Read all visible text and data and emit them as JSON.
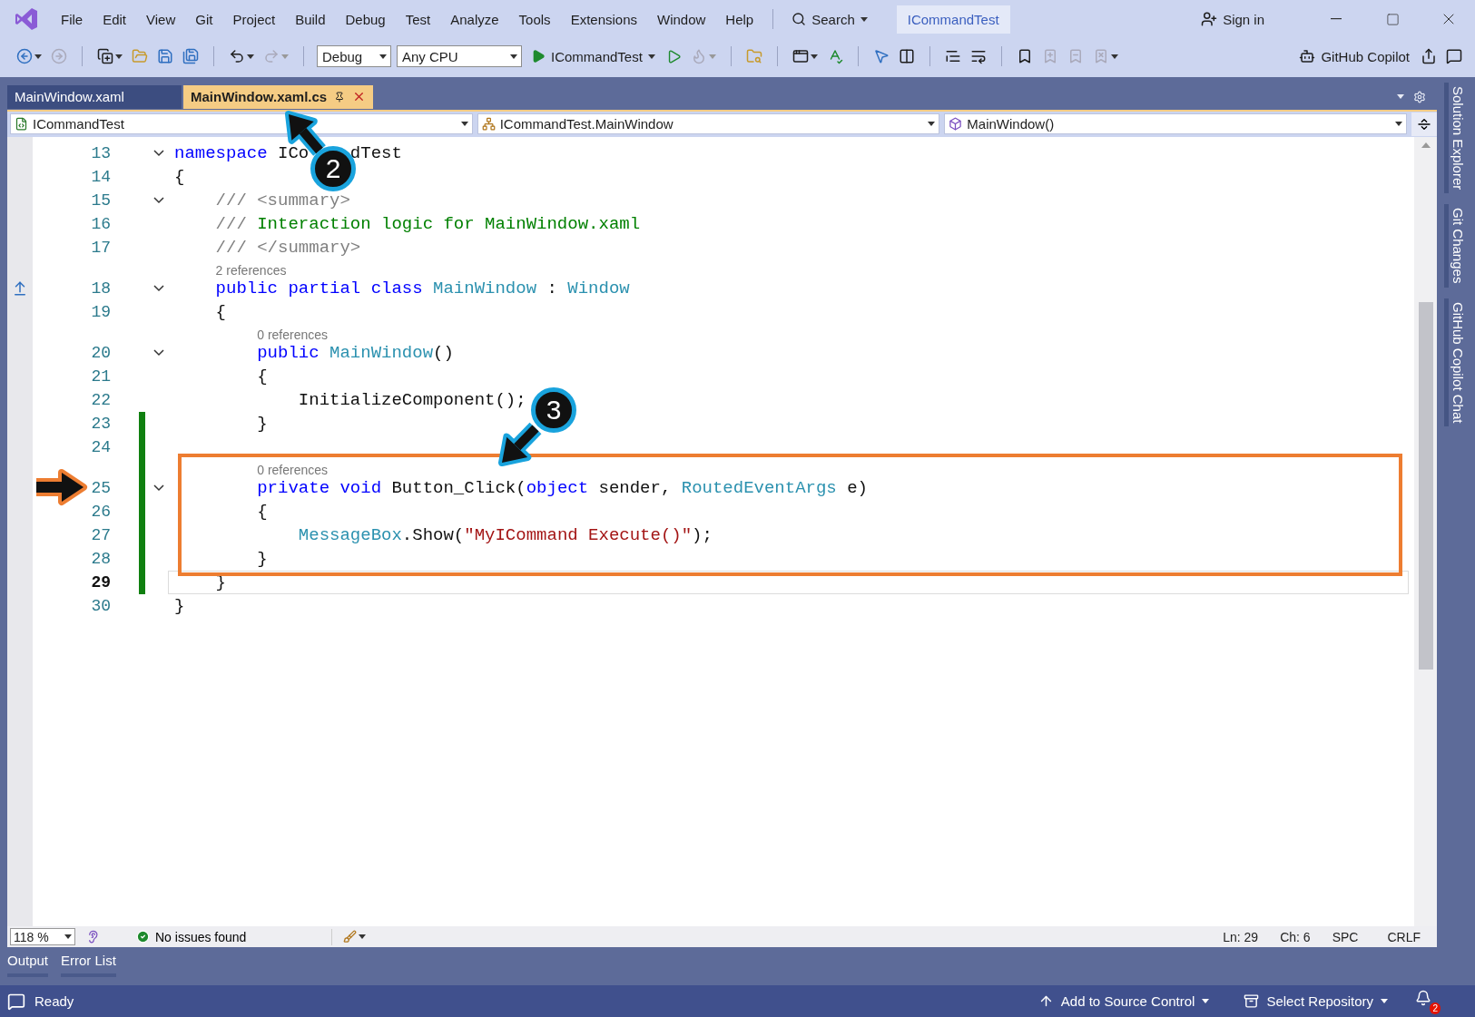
{
  "menu_bar": {
    "menus": [
      "File",
      "Edit",
      "View",
      "Git",
      "Project",
      "Build",
      "Debug",
      "Test",
      "Analyze",
      "Tools",
      "Extensions",
      "Window",
      "Help"
    ],
    "search": "Search",
    "solution": "ICommandTest",
    "sign_in": "Sign in"
  },
  "toolbar": {
    "configuration": "Debug",
    "platform": "Any CPU",
    "startup": "ICommandTest",
    "copilot": "GitHub Copilot"
  },
  "document_tabs": [
    {
      "label": "MainWindow.xaml",
      "selected": false
    },
    {
      "label": "MainWindow.xaml.cs",
      "selected": true
    }
  ],
  "navigation": {
    "project": "ICommandTest",
    "type": "ICommandTest.MainWindow",
    "member": "MainWindow()"
  },
  "code_lines": [
    {
      "kind": "code",
      "number": "13",
      "fold": true,
      "changed": false,
      "current": false,
      "marker": false,
      "tokens": [
        {
          "t": "namespace",
          "kind": "kw"
        },
        {
          "t": " ICo    dTest",
          "kind": "plain"
        }
      ]
    },
    {
      "kind": "code",
      "number": "14",
      "fold": false,
      "changed": false,
      "current": false,
      "marker": false,
      "tokens": [
        {
          "t": "{",
          "kind": "plain"
        }
      ]
    },
    {
      "kind": "code",
      "number": "15",
      "fold": true,
      "changed": false,
      "current": false,
      "marker": false,
      "tokens": [
        {
          "t": "    /// <summary>",
          "kind": "doc"
        }
      ]
    },
    {
      "kind": "code",
      "number": "16",
      "fold": false,
      "changed": false,
      "current": false,
      "marker": false,
      "tokens": [
        {
          "t": "    /// ",
          "kind": "doc"
        },
        {
          "t": "Interaction logic for MainWindow.xaml",
          "kind": "comment"
        }
      ]
    },
    {
      "kind": "code",
      "number": "17",
      "fold": false,
      "changed": false,
      "current": false,
      "marker": false,
      "tokens": [
        {
          "t": "    /// </summary>",
          "kind": "doc"
        }
      ]
    },
    {
      "kind": "lens",
      "text": "2 references",
      "changed": false
    },
    {
      "kind": "code",
      "number": "18",
      "fold": true,
      "changed": false,
      "current": false,
      "marker": true,
      "tokens": [
        {
          "t": "    public partial class ",
          "kind": "kw"
        },
        {
          "t": "MainWindow",
          "kind": "type"
        },
        {
          "t": " : ",
          "kind": "plain"
        },
        {
          "t": "Window",
          "kind": "type"
        }
      ]
    },
    {
      "kind": "code",
      "number": "19",
      "fold": false,
      "changed": false,
      "current": false,
      "marker": false,
      "tokens": [
        {
          "t": "    {",
          "kind": "plain"
        }
      ]
    },
    {
      "kind": "lens",
      "text": "0 references",
      "changed": false
    },
    {
      "kind": "code",
      "number": "20",
      "fold": true,
      "changed": false,
      "current": false,
      "marker": false,
      "tokens": [
        {
          "t": "        public ",
          "kind": "kw"
        },
        {
          "t": "MainWindow",
          "kind": "type"
        },
        {
          "t": "()",
          "kind": "plain"
        }
      ]
    },
    {
      "kind": "code",
      "number": "21",
      "fold": false,
      "changed": false,
      "current": false,
      "marker": false,
      "tokens": [
        {
          "t": "        {",
          "kind": "plain"
        }
      ]
    },
    {
      "kind": "code",
      "number": "22",
      "fold": false,
      "changed": false,
      "current": false,
      "marker": false,
      "tokens": [
        {
          "t": "            InitializeComponent();",
          "kind": "plain"
        }
      ]
    },
    {
      "kind": "code",
      "number": "23",
      "fold": false,
      "changed": true,
      "current": false,
      "marker": false,
      "tokens": [
        {
          "t": "        }",
          "kind": "plain"
        }
      ]
    },
    {
      "kind": "code",
      "number": "24",
      "fold": false,
      "changed": true,
      "current": false,
      "marker": false
    },
    {
      "kind": "lens",
      "text": "0 references",
      "changed": true
    },
    {
      "kind": "code",
      "number": "25",
      "fold": true,
      "changed": true,
      "current": false,
      "marker": false,
      "tokens": [
        {
          "t": "        private void ",
          "kind": "kw"
        },
        {
          "t": "Button_Click(",
          "kind": "plain"
        },
        {
          "t": "object",
          "kind": "kw"
        },
        {
          "t": " sender, ",
          "kind": "plain"
        },
        {
          "t": "RoutedEventArgs",
          "kind": "type"
        },
        {
          "t": " e)",
          "kind": "plain"
        }
      ]
    },
    {
      "kind": "code",
      "number": "26",
      "fold": false,
      "changed": true,
      "current": false,
      "marker": false,
      "tokens": [
        {
          "t": "        {",
          "kind": "plain"
        }
      ]
    },
    {
      "kind": "code",
      "number": "27",
      "fold": false,
      "changed": true,
      "current": false,
      "marker": false,
      "tokens": [
        {
          "t": "            MessageBox",
          "kind": "type"
        },
        {
          "t": ".Show(",
          "kind": "plain"
        },
        {
          "t": "\"MyICommand Execute()\"",
          "kind": "string"
        },
        {
          "t": ");",
          "kind": "plain"
        }
      ]
    },
    {
      "kind": "code",
      "number": "28",
      "fold": false,
      "changed": true,
      "current": false,
      "marker": false,
      "tokens": [
        {
          "t": "        }",
          "kind": "plain"
        }
      ]
    },
    {
      "kind": "code",
      "number": "29",
      "fold": false,
      "changed": true,
      "current": true,
      "marker": false,
      "tokens": [
        {
          "t": "    }",
          "kind": "plain"
        }
      ]
    },
    {
      "kind": "code",
      "number": "30",
      "fold": false,
      "changed": false,
      "current": false,
      "marker": false,
      "tokens": [
        {
          "t": "}",
          "kind": "plain"
        }
      ]
    }
  ],
  "editor_status": {
    "zoom": "118 %",
    "issues": "No issues found",
    "line": "Ln: 29",
    "column": "Ch: 6",
    "indent": "SPC",
    "line_ending": "CRLF"
  },
  "tool_tabs": [
    "Output",
    "Error List"
  ],
  "side_tabs": [
    "Solution Explorer",
    "Git Changes",
    "GitHub Copilot Chat"
  ],
  "status_bar": {
    "state": "Ready",
    "source_control": "Add to Source Control",
    "repository": "Select Repository",
    "notifications": "2"
  },
  "annotations": {
    "callouts": [
      {
        "label": "2"
      },
      {
        "label": "3"
      }
    ]
  }
}
